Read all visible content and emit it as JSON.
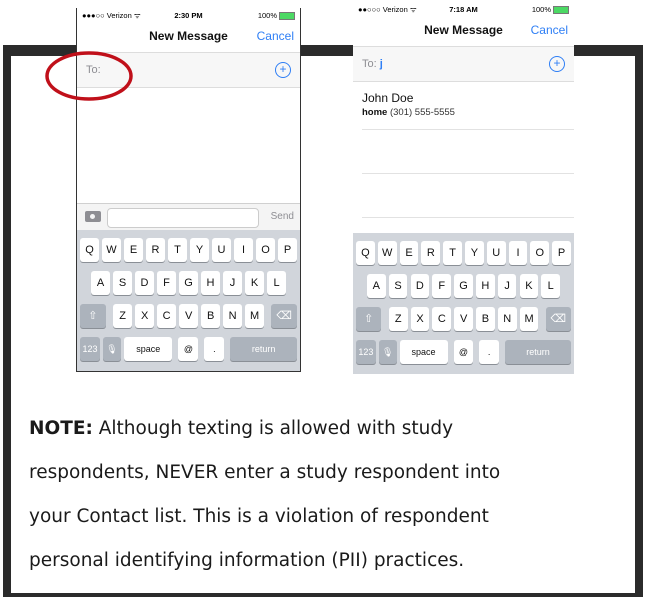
{
  "phone1": {
    "status": {
      "carrier": "●●●○○ Verizon ᯤ",
      "time": "2:30 PM",
      "battery": "100%"
    },
    "nav": {
      "title": "New Message",
      "cancel": "Cancel"
    },
    "to_label": "To:",
    "compose": {
      "send": "Send"
    }
  },
  "phone2": {
    "status": {
      "carrier": "●●○○○ Verizon ᯤ",
      "time": "7:18 AM",
      "battery": "100%"
    },
    "nav": {
      "title": "New Message",
      "cancel": "Cancel"
    },
    "to_label": "To: ",
    "to_typed": "j",
    "contact": {
      "name": "John Doe",
      "type": "home",
      "phone": "(301) 555-5555"
    }
  },
  "keyboard": {
    "row1": [
      "Q",
      "W",
      "E",
      "R",
      "T",
      "Y",
      "U",
      "I",
      "O",
      "P"
    ],
    "row2": [
      "A",
      "S",
      "D",
      "F",
      "G",
      "H",
      "J",
      "K",
      "L"
    ],
    "row3": [
      "Z",
      "X",
      "C",
      "V",
      "B",
      "N",
      "M"
    ],
    "bottom": {
      "num": "123",
      "space": "space",
      "at": "@",
      "dot": ".",
      "return": "return"
    }
  },
  "note": {
    "prefix": "NOTE:",
    "line1": " Although texting is allowed with study",
    "line2": "respondents, NEVER enter a study respondent into",
    "line3": "your Contact list. This is a violation of respondent",
    "line4": "personal identifying information (PII) practices."
  },
  "colors": {
    "highlight_circle": "#c0101a",
    "ios_blue": "#2f7ff5",
    "frame": "#2b2b2b"
  }
}
